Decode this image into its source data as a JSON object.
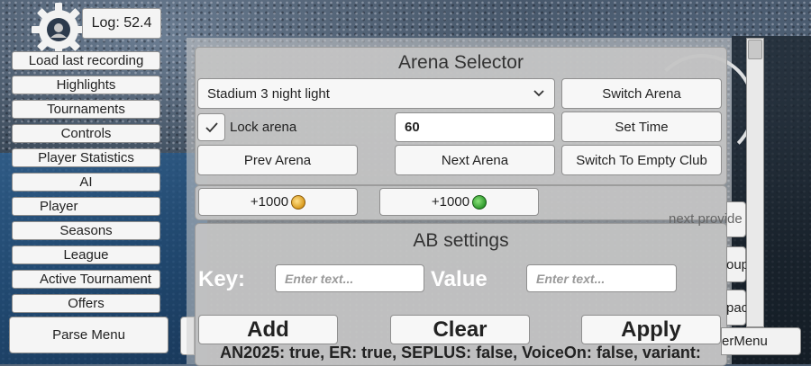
{
  "log": {
    "label": "Log: 52.4"
  },
  "sidebar": {
    "items": [
      {
        "label": "Load last recording"
      },
      {
        "label": "Highlights"
      },
      {
        "label": "Tournaments"
      },
      {
        "label": "Controls"
      },
      {
        "label": "Player Statistics"
      },
      {
        "label": "AI"
      },
      {
        "label": "Player"
      },
      {
        "label": "Seasons"
      },
      {
        "label": "League"
      },
      {
        "label": "Active Tournament"
      },
      {
        "label": "Offers"
      }
    ],
    "parse_menu": "Parse Menu"
  },
  "arena_selector": {
    "title": "Arena Selector",
    "selected_arena": "Stadium 3 night light",
    "switch_arena": "Switch Arena",
    "lock_arena_label": "Lock arena",
    "lock_arena_checked": true,
    "time_value": "60",
    "set_time": "Set Time",
    "prev_arena": "Prev Arena",
    "next_arena": "Next Arena",
    "switch_empty_club": "Switch To Empty Club"
  },
  "currency": {
    "gold_button": "+1000",
    "green_button": "+1000",
    "gold_icon": "gold-coin-icon",
    "green_icon": "green-gem-icon"
  },
  "ab_settings": {
    "title": "AB settings",
    "key_label": "Key:",
    "key_placeholder": "Enter text...",
    "value_label": "Value",
    "value_placeholder": "Enter text...",
    "add": "Add",
    "clear": "Clear",
    "apply": "Apply",
    "status": "AN2025: true, ER: true, SEPLUS: false, VoiceOn: false, variant:"
  },
  "right_panel": {
    "next_provider": "next provide",
    "group": "oup",
    "space": "pace",
    "menu": "erMenu"
  }
}
